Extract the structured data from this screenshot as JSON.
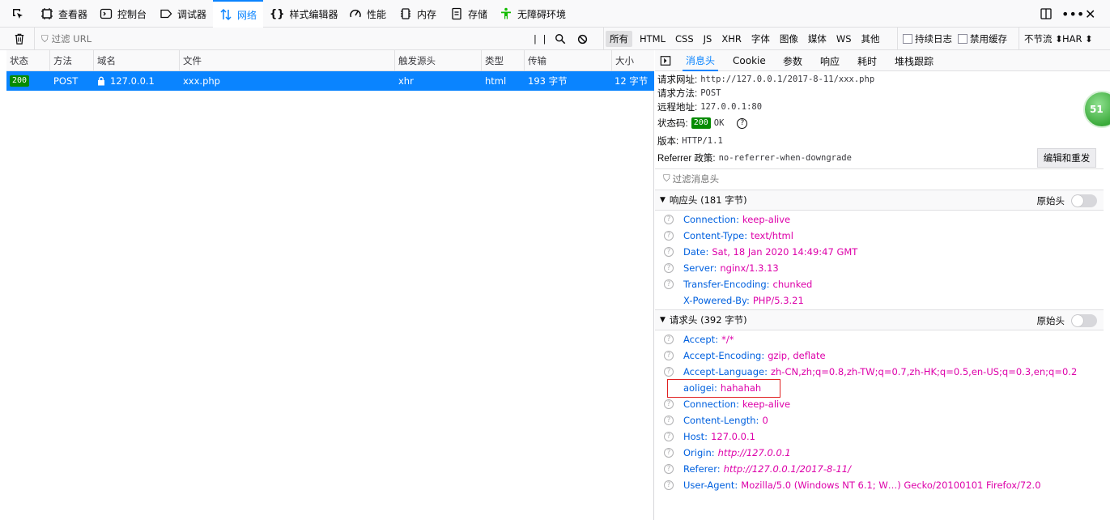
{
  "toolbar": {
    "tabs": [
      {
        "label": "查看器",
        "icon": "inspector-icon"
      },
      {
        "label": "控制台",
        "icon": "console-icon"
      },
      {
        "label": "调试器",
        "icon": "debugger-icon"
      },
      {
        "label": "网络",
        "icon": "network-icon",
        "active": true
      },
      {
        "label": "样式编辑器",
        "icon": "style-editor-icon"
      },
      {
        "label": "性能",
        "icon": "performance-icon"
      },
      {
        "label": "内存",
        "icon": "memory-icon"
      },
      {
        "label": "存储",
        "icon": "storage-icon"
      },
      {
        "label": "无障碍环境",
        "icon": "accessibility-icon"
      }
    ]
  },
  "filterbar": {
    "url_placeholder": "过滤 URL",
    "types": [
      "所有",
      "HTML",
      "CSS",
      "JS",
      "XHR",
      "字体",
      "图像",
      "媒体",
      "WS",
      "其他"
    ],
    "persist_logs": "持续日志",
    "disable_cache": "禁用缓存",
    "throttle": "不节流 ⬍",
    "har": "HAR ⬍"
  },
  "request_table": {
    "columns": [
      "状态",
      "方法",
      "域名",
      "文件",
      "触发源头",
      "类型",
      "传输",
      "大小"
    ],
    "rows": [
      {
        "status": "200",
        "method": "POST",
        "domain": "127.0.0.1",
        "file": "xxx.php",
        "cause": "xhr",
        "type": "html",
        "transferred": "193 字节",
        "size": "12 字节"
      }
    ]
  },
  "details": {
    "tabs": [
      "消息头",
      "Cookie",
      "参数",
      "响应",
      "耗时",
      "堆栈跟踪"
    ],
    "summary": {
      "url_label": "请求网址:",
      "url": "http://127.0.0.1/2017-8-11/xxx.php",
      "method_label": "请求方法:",
      "method": "POST",
      "remote_label": "远程地址:",
      "remote": "127.0.0.1:80",
      "status_label": "状态码:",
      "status_code": "200",
      "status_text": "OK",
      "version_label": "版本:",
      "version": "HTTP/1.1",
      "referrer_label": "Referrer 政策:",
      "referrer": "no-referrer-when-downgrade"
    },
    "resend_button": "编辑和重发",
    "filter_placeholder": "过滤消息头",
    "raw_label": "原始头",
    "response_headers_title": "响应头 (181 字节)",
    "response_headers": [
      {
        "name": "Connection:",
        "value": "keep-alive",
        "help": true
      },
      {
        "name": "Content-Type:",
        "value": "text/html",
        "help": true
      },
      {
        "name": "Date:",
        "value": "Sat, 18 Jan 2020 14:49:47 GMT",
        "help": true
      },
      {
        "name": "Server:",
        "value": "nginx/1.3.13",
        "help": true
      },
      {
        "name": "Transfer-Encoding:",
        "value": "chunked",
        "help": true
      },
      {
        "name": "X-Powered-By:",
        "value": "PHP/5.3.21",
        "help": false
      }
    ],
    "request_headers_title": "请求头 (392 字节)",
    "request_headers": [
      {
        "name": "Accept:",
        "value": "*/*",
        "help": true
      },
      {
        "name": "Accept-Encoding:",
        "value": "gzip, deflate",
        "help": true
      },
      {
        "name": "Accept-Language:",
        "value": "zh-CN,zh;q=0.8,zh-TW;q=0.7,zh-HK;q=0.5,en-US;q=0.3,en;q=0.2",
        "help": true
      },
      {
        "name": "aoligei:",
        "value": "hahahah",
        "help": false
      },
      {
        "name": "Connection:",
        "value": "keep-alive",
        "help": true
      },
      {
        "name": "Content-Length:",
        "value": "0",
        "help": true
      },
      {
        "name": "Host:",
        "value": "127.0.0.1",
        "help": true
      },
      {
        "name": "Origin:",
        "value": "http://127.0.0.1",
        "help": true,
        "italic": true
      },
      {
        "name": "Referer:",
        "value": "http://127.0.0.1/2017-8-11/",
        "help": true,
        "italic": true
      },
      {
        "name": "User-Agent:",
        "value": "Mozilla/5.0 (Windows NT 6.1; W…) Gecko/20100101 Firefox/72.0",
        "help": true
      }
    ]
  },
  "overlay_badge": "51"
}
